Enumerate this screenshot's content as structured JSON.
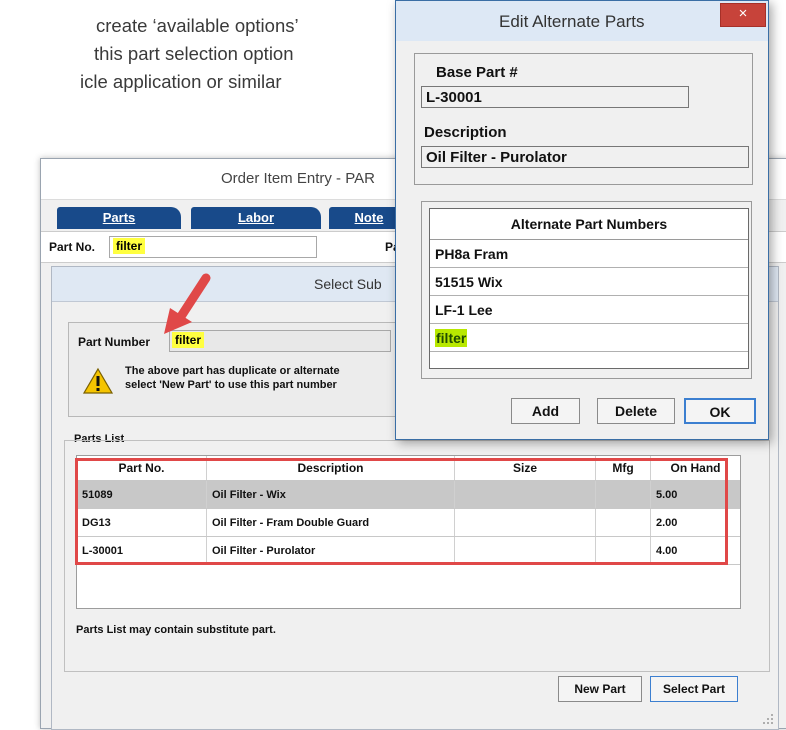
{
  "intro": {
    "line1": "create ‘available options’",
    "line2": "this part selection option",
    "line3": "icle application or similar"
  },
  "order_window": {
    "title": "Order Item Entry - PAR",
    "tabs": [
      "Parts",
      "Labor",
      "Note"
    ],
    "part_no_label": "Part No.",
    "part_no_value": "filter",
    "side_label": "Pa"
  },
  "select_dialog": {
    "title": "Select Sub",
    "part_number_label": "Part Number",
    "part_number_value": "filter",
    "warning_line1": "The above part has duplicate or alternate",
    "warning_line2": "select 'New Part' to use this part number",
    "parts_list_label": "Parts List",
    "columns": [
      "Part No.",
      "Description",
      "Size",
      "Mfg",
      "On Hand"
    ],
    "rows": [
      {
        "part": "51089",
        "desc": "Oil Filter - Wix",
        "size": "",
        "mfg": "",
        "on_hand": "5.00"
      },
      {
        "part": "DG13",
        "desc": "Oil Filter - Fram Double Guard",
        "size": "",
        "mfg": "",
        "on_hand": "2.00"
      },
      {
        "part": "L-30001",
        "desc": "Oil Filter - Purolator",
        "size": "",
        "mfg": "",
        "on_hand": "4.00"
      }
    ],
    "footer_note": "Parts List may contain substitute part.",
    "new_part_label": "New Part",
    "select_part_label": "Select Part"
  },
  "edit_dialog": {
    "title": "Edit Alternate Parts",
    "close_glyph": "×",
    "base_part_label": "Base Part #",
    "base_part_value": "L-30001",
    "description_label": "Description",
    "description_value": "Oil Filter - Purolator",
    "alt_header": "Alternate Part Numbers",
    "alt_items": [
      "PH8a Fram",
      "51515 Wix",
      "LF-1 Lee",
      "filter"
    ],
    "add_label": "Add",
    "delete_label": "Delete",
    "ok_label": "OK"
  },
  "colors": {
    "tab_blue": "#184a8a",
    "highlight_yellow": "#ffff40",
    "highlight_green": "#b8e800",
    "annotation_red": "#e04848",
    "close_red": "#c7433a"
  }
}
